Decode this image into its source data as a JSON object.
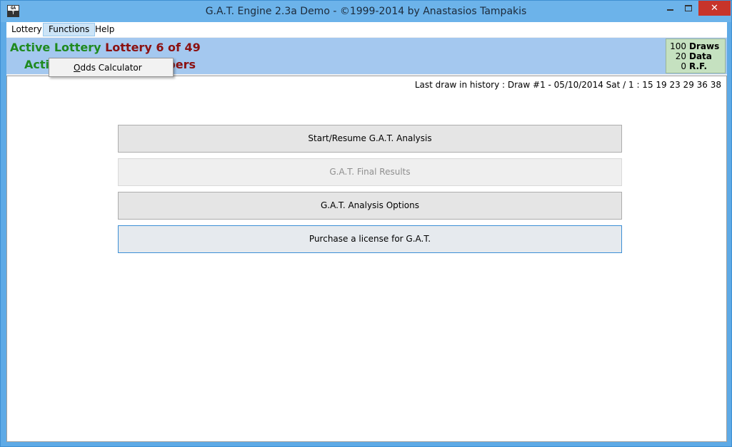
{
  "window": {
    "title": "G.A.T. Engine 2.3a Demo  - ©1999-2014 by Anastasios Tampakis",
    "icon_top": "GA",
    "icon_bottom": "T",
    "close_glyph": "✕"
  },
  "menubar": {
    "items": [
      {
        "label": "Lottery"
      },
      {
        "label": "Functions"
      },
      {
        "label": "Help"
      }
    ]
  },
  "functions_menu": {
    "items": [
      {
        "label_prefix": "O",
        "label_rest": "dds Calculator"
      }
    ]
  },
  "infobar": {
    "active_lottery_label": "Active Lottery",
    "active_lottery_value": "Lottery 6 of 49",
    "active_field_label": "Active Field",
    "active_field_value": "Main numbers",
    "stats": [
      {
        "value": "100",
        "label": "Draws"
      },
      {
        "value": "20",
        "label": "Data"
      },
      {
        "value": "0",
        "label": "R.F."
      }
    ]
  },
  "main": {
    "last_draw": "Last draw in history : Draw #1 - 05/10/2014  Sat / 1 : 15 19 23 29 36 38",
    "buttons": [
      {
        "label": "Start/Resume G.A.T. Analysis",
        "enabled": true
      },
      {
        "label": "G.A.T. Final Results",
        "enabled": false
      },
      {
        "label": "G.A.T. Analysis Options",
        "enabled": true
      },
      {
        "label": "Purchase a license for G.A.T.",
        "enabled": true,
        "focused": true
      }
    ]
  },
  "colors": {
    "title_bar": "#6cb3ea",
    "info_bar": "#a4c8ef",
    "label_green": "#1f8a1f",
    "value_red": "#8b1010",
    "stats_bg": "#c5e1c0",
    "close_button": "#c7342a"
  }
}
